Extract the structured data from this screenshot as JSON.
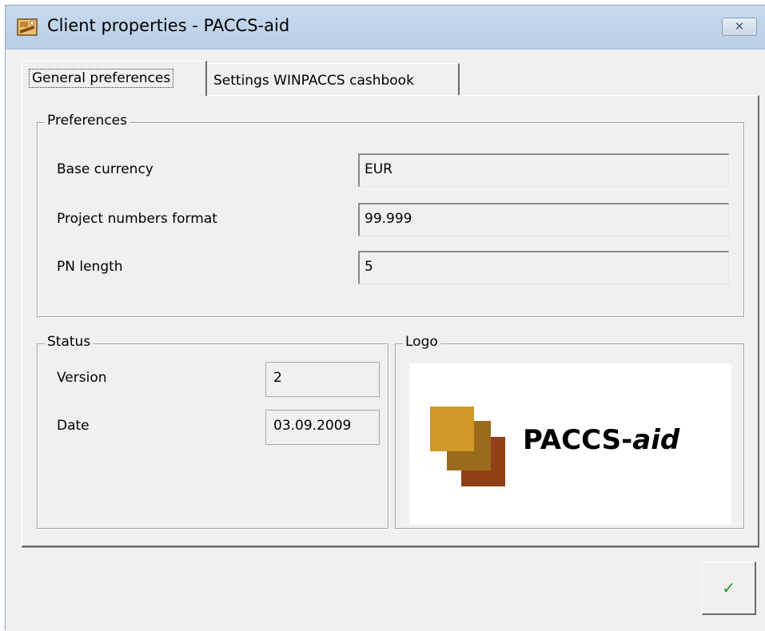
{
  "window": {
    "title": "Client properties - PACCS-aid",
    "close_label": "✕"
  },
  "tabs": [
    {
      "label": "General preferences",
      "active": true
    },
    {
      "label": "Settings WINPACCS cashbook",
      "active": false
    }
  ],
  "preferences": {
    "legend": "Preferences",
    "fields": [
      {
        "label": "Base currency",
        "value": "EUR"
      },
      {
        "label": "Project numbers format",
        "value": "99.999"
      },
      {
        "label": "PN length",
        "value": "5"
      }
    ]
  },
  "status": {
    "legend": "Status",
    "fields": [
      {
        "label": "Version",
        "value": "2"
      },
      {
        "label": "Date",
        "value": "03.09.2009"
      }
    ]
  },
  "logo": {
    "legend": "Logo",
    "brand": "PACCS-",
    "brand_suffix": "aid",
    "colors": [
      "#d0972a",
      "#9a6a1d",
      "#914018"
    ]
  },
  "buttons": {
    "ok_label": "✓"
  },
  "icons": {
    "app": "app-icon",
    "close": "close-icon",
    "ok": "checkmark-icon"
  }
}
